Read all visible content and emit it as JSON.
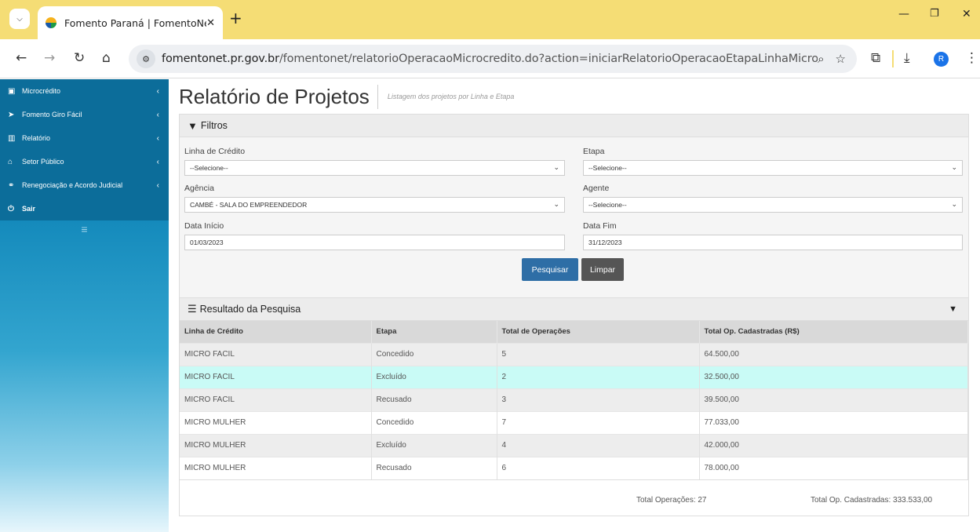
{
  "browser": {
    "tab_title": "Fomento Paraná | FomentoNet",
    "url_host": "fomentonet.pr.gov.br",
    "url_path": "/fomentonet/relatorioOperacaoMicrocredito.do?action=iniciarRelatorioOperacaoEtapaLinhaMicrocredito",
    "avatar_letter": "R",
    "tab_strip_color": "#f5dd75"
  },
  "sidebar": {
    "items": [
      {
        "icon": "money-icon",
        "label": "Microcrédito"
      },
      {
        "icon": "paper-plane-icon",
        "label": "Fomento Giro Fácil"
      },
      {
        "icon": "bar-chart-icon",
        "label": "Relatório"
      },
      {
        "icon": "bank-icon",
        "label": "Setor Público"
      },
      {
        "icon": "handshake-icon",
        "label": "Renegociação e Acordo Judicial"
      },
      {
        "icon": "power-icon",
        "label": "Sair"
      }
    ]
  },
  "page": {
    "title": "Relatório de Projetos",
    "subtitle": "Listagem dos projetos por Linha e Etapa"
  },
  "filters": {
    "heading": "Filtros",
    "linha_label": "Linha de Crédito",
    "linha_value": "--Selecione--",
    "etapa_label": "Etapa",
    "etapa_value": "--Selecione--",
    "agencia_label": "Agência",
    "agencia_value": "CAMBÉ - SALA DO EMPREENDEDOR",
    "agente_label": "Agente",
    "agente_value": "--Selecione--",
    "data_inicio_label": "Data Início",
    "data_inicio_value": "01/03/2023",
    "data_fim_label": "Data Fim",
    "data_fim_value": "31/12/2023",
    "search_button": "Pesquisar",
    "clear_button": "Limpar"
  },
  "results": {
    "heading": "Resultado da Pesquisa",
    "columns": [
      "Linha de Crédito",
      "Etapa",
      "Total de Operações",
      "Total Op. Cadastradas (R$)"
    ],
    "rows": [
      [
        "MICRO FACIL",
        "Concedido",
        "5",
        "64.500,00"
      ],
      [
        "MICRO FACIL",
        "Excluído",
        "2",
        "32.500,00"
      ],
      [
        "MICRO FACIL",
        "Recusado",
        "3",
        "39.500,00"
      ],
      [
        "MICRO MULHER",
        "Concedido",
        "7",
        "77.033,00"
      ],
      [
        "MICRO MULHER",
        "Excluído",
        "4",
        "42.000,00"
      ],
      [
        "MICRO MULHER",
        "Recusado",
        "6",
        "78.000,00"
      ]
    ],
    "total_operacoes": "Total Operações: 27",
    "total_cadastradas": "Total Op. Cadastradas: 333.533,00",
    "highlight_color": "#c9fbf6"
  }
}
